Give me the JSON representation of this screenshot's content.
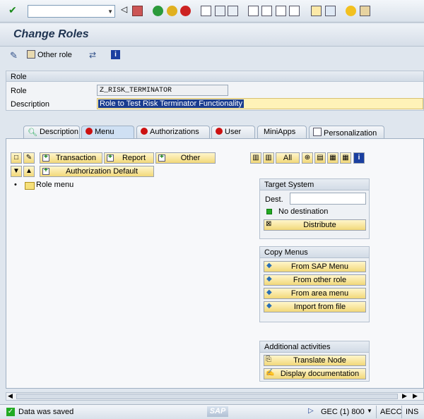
{
  "toolbar": {
    "command_field": ""
  },
  "title": "Change Roles",
  "app_toolbar": {
    "other_role_label": "Other role"
  },
  "role": {
    "section_label": "Role",
    "role_label": "Role",
    "role_value": "Z_RISK_TERMINATOR",
    "description_label": "Description",
    "description_value": "Role to Test Risk Terminator Functionality"
  },
  "tabs": [
    {
      "label": "Description",
      "icon": "search-icon"
    },
    {
      "label": "Menu",
      "icon": "red-status-icon"
    },
    {
      "label": "Authorizations",
      "icon": "red-status-icon"
    },
    {
      "label": "User",
      "icon": "red-status-icon"
    },
    {
      "label": "MiniApps",
      "icon": ""
    },
    {
      "label": "Personalization",
      "icon": "document-icon"
    }
  ],
  "menu": {
    "transaction_label": "Transaction",
    "report_label": "Report",
    "other_label": "Other",
    "authorization_default_label": "Authorization Default",
    "all_label": "All",
    "tree_root": "Role menu"
  },
  "target_system": {
    "title": "Target System",
    "dest_label": "Dest.",
    "dest_value": "",
    "status_text": "No destination",
    "status_color": "#22aa22",
    "distribute_label": "Distribute"
  },
  "copy_menus": {
    "title": "Copy Menus",
    "items": [
      "From SAP Menu",
      "From other role",
      "From area menu",
      "Import from file"
    ]
  },
  "additional": {
    "title": "Additional activities",
    "items": [
      "Translate Node",
      "Display documentation"
    ]
  },
  "status": {
    "message": "Data was saved",
    "logo": "SAP",
    "system": "GEC (1) 800",
    "server": "AECC",
    "mode": "INS"
  },
  "colors": {
    "accent": "#f2d879",
    "title": "#1e3350",
    "error": "#cc1111"
  }
}
